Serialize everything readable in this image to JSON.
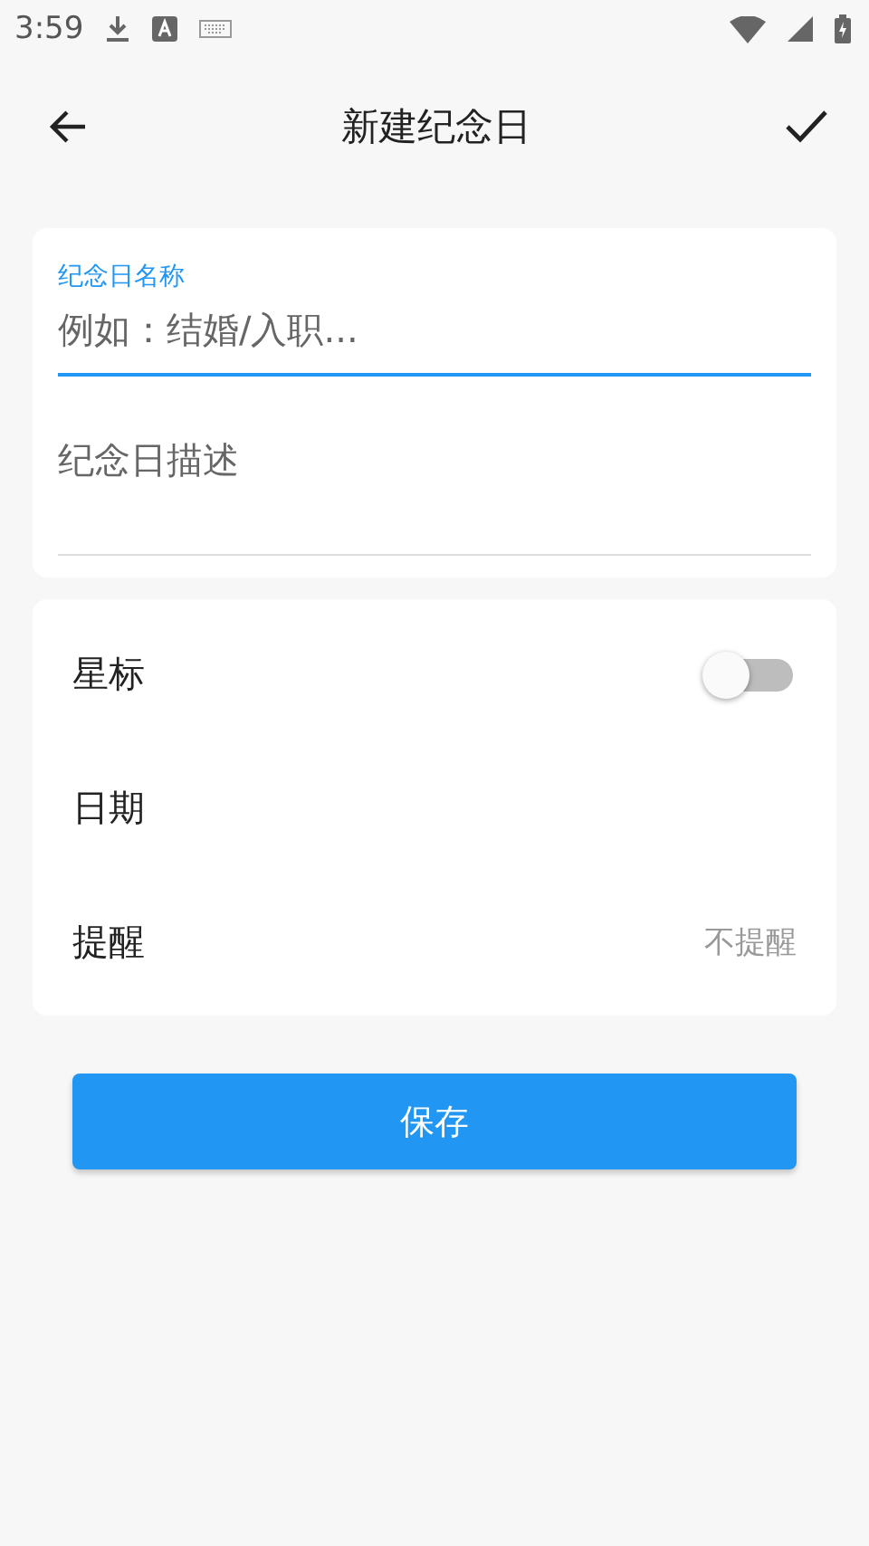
{
  "status_bar": {
    "time": "3:59"
  },
  "app_bar": {
    "title": "新建纪念日"
  },
  "fields": [
    {
      "label": "纪念日名称",
      "placeholder": "例如：结婚/入职...",
      "focused": true
    },
    {
      "placeholder": "纪念日描述",
      "focused": false
    }
  ],
  "settings": [
    {
      "kind": "toggle",
      "label": "星标",
      "on": false
    },
    {
      "kind": "plain",
      "label": "日期"
    },
    {
      "kind": "value",
      "label": "提醒",
      "value": "不提醒"
    }
  ],
  "save_button": {
    "label": "保存"
  }
}
